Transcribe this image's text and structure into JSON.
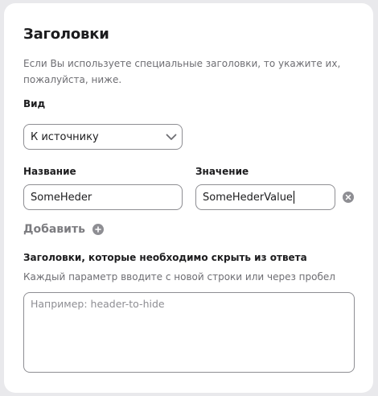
{
  "section": {
    "title": "Заголовки",
    "description": "Если Вы используете специальные заголовки, то укажите их, пожалуйста, ниже."
  },
  "view": {
    "label": "Вид",
    "selected": "К источнику"
  },
  "header_row": {
    "name_label": "Название",
    "value_label": "Значение",
    "name_value": "SomeHeder",
    "value_value": "SomeHederValue"
  },
  "add": {
    "label": "Добавить"
  },
  "hide": {
    "label": "Заголовки, которые необходимо скрыть из ответа",
    "hint": "Каждый параметр вводите с новой строки или через пробел",
    "placeholder": "Например: header-to-hide"
  },
  "icons": {
    "dropdown": "chevron-down-icon",
    "clear": "clear-x-icon",
    "add": "plus-circle-icon"
  }
}
